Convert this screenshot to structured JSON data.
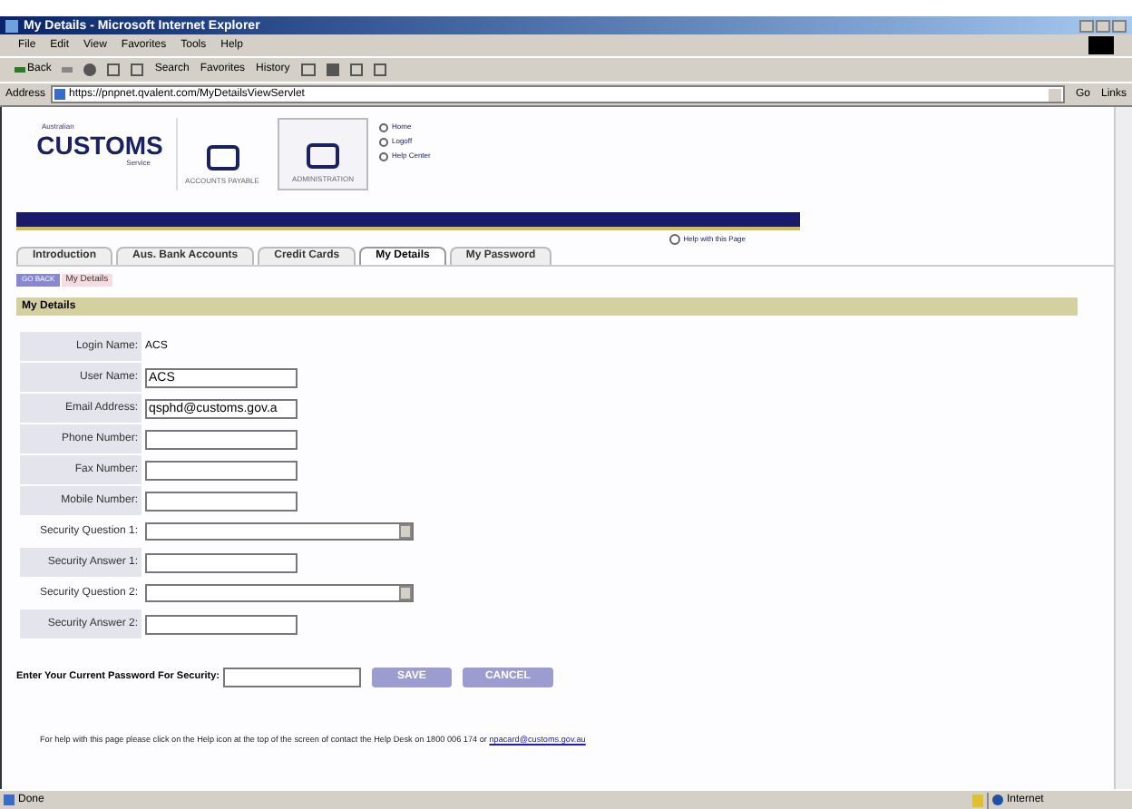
{
  "window": {
    "title": "My Details - Microsoft Internet Explorer"
  },
  "menu": [
    "File",
    "Edit",
    "View",
    "Favorites",
    "Tools",
    "Help"
  ],
  "toolbar": {
    "back": "Back",
    "search": "Search",
    "favorites": "Favorites",
    "history": "History"
  },
  "address": {
    "label": "Address",
    "url": "https://pnpnet.qvalent.com/MyDetailsViewServlet",
    "go": "Go",
    "links": "Links"
  },
  "header": {
    "logo_top": "Australian",
    "logo": "CUSTOMS",
    "logo_bottom": "Service",
    "sections": [
      {
        "label": "ACCOUNTS PAYABLE",
        "selected": false
      },
      {
        "label": "ADMINISTRATION",
        "selected": true
      }
    ],
    "links": [
      "Home",
      "Logoff",
      "Help Center"
    ],
    "help": "Help with this Page"
  },
  "tabs": [
    {
      "label": "Introduction",
      "selected": false
    },
    {
      "label": "Aus. Bank Accounts",
      "selected": false
    },
    {
      "label": "Credit Cards",
      "selected": false
    },
    {
      "label": "My Details",
      "selected": true
    },
    {
      "label": "My Password",
      "selected": false
    }
  ],
  "breadcrumb": {
    "back": "GO BACK",
    "current": "My Details"
  },
  "section_title": "My Details",
  "fields": [
    {
      "label": "Login Name:",
      "kind": "static",
      "value": "ACS"
    },
    {
      "label": "User Name:",
      "kind": "text",
      "value": "ACS"
    },
    {
      "label": "Email Address:",
      "kind": "text",
      "value": "qsphd@customs.gov.a"
    },
    {
      "label": "Phone Number:",
      "kind": "text"
    },
    {
      "label": "Fax Number:",
      "kind": "text"
    },
    {
      "label": "Mobile Number:",
      "kind": "text"
    },
    {
      "label": "Security Question 1:",
      "kind": "select"
    },
    {
      "label": "Security Answer 1:",
      "kind": "text"
    },
    {
      "label": "Security Question 2:",
      "kind": "select"
    },
    {
      "label": "Security Answer 2:",
      "kind": "text"
    }
  ],
  "password": {
    "label": "Enter Your Current Password For Security:",
    "save": "SAVE",
    "cancel": "CANCEL"
  },
  "help_text": {
    "text": "For help with this page please click on the Help icon at the top of the screen of contact the Help Desk on 1800 006 174 or",
    "link": "npacard@customs.gov.au"
  },
  "status_bar": {
    "text": "Done",
    "zone": "Internet"
  }
}
